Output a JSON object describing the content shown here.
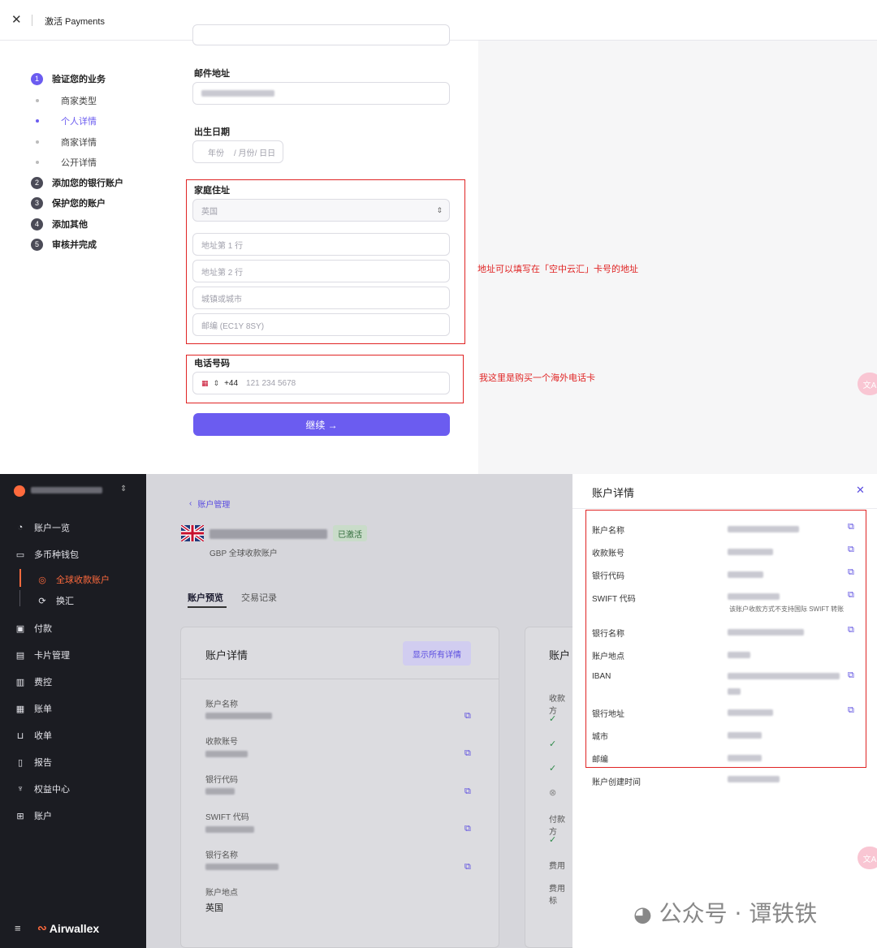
{
  "top": {
    "title": "激活 Payments",
    "close_icon": "close-icon",
    "steps": [
      {
        "num": "1",
        "label": "验证您的业务"
      },
      {
        "num": "2",
        "label": "添加您的银行账户"
      },
      {
        "num": "3",
        "label": "保护您的账户"
      },
      {
        "num": "4",
        "label": "添加其他"
      },
      {
        "num": "5",
        "label": "审核并完成"
      }
    ],
    "substeps": [
      "商家类型",
      "个人详情",
      "商家详情",
      "公开详情"
    ],
    "email_label": "邮件地址",
    "dob_label": "出生日期",
    "dob_year": "年份",
    "dob_month": "/ 月份",
    "dob_day": "/ 日日",
    "home_label": "家庭住址",
    "country": "英国",
    "addr1": "地址第 1 行",
    "addr2": "地址第 2 行",
    "city": "城镇或城市",
    "postcode": "邮编 (EC1Y 8SY)",
    "phone_label": "电话号码",
    "phone_code": "+44",
    "phone_placeholder": "121 234 5678",
    "continue": "继续 →",
    "note_address": "地址可以填写在「空中云汇」卡号的地址",
    "note_phone": "我这里是购买一个海外电话卡",
    "accent": "#6b5cf0",
    "annotation_color": "#e02424"
  },
  "sidebar": {
    "items": [
      {
        "icon": "gauge-icon",
        "label": "账户一览"
      },
      {
        "icon": "wallet-icon",
        "label": "多币种钱包"
      },
      {
        "icon": "payment-icon",
        "label": "付款"
      },
      {
        "icon": "card-icon",
        "label": "卡片管理"
      },
      {
        "icon": "expense-icon",
        "label": "费控"
      },
      {
        "icon": "bill-icon",
        "label": "账单"
      },
      {
        "icon": "cart-icon",
        "label": "收单"
      },
      {
        "icon": "report-icon",
        "label": "报告"
      },
      {
        "icon": "trophy-icon",
        "label": "权益中心"
      },
      {
        "icon": "store-icon",
        "label": "账户"
      }
    ],
    "subitems": [
      {
        "icon": "global-account-icon",
        "label": "全球收款账户"
      },
      {
        "icon": "exchange-icon",
        "label": "换汇"
      }
    ],
    "brand": "Airwallex",
    "active_color": "#ff6a3d"
  },
  "main": {
    "breadcrumb": "账户管理",
    "status": "已激活",
    "account_sub": "GBP 全球收款账户",
    "tabs": [
      "账户预览",
      "交易记录"
    ],
    "card_title": "账户详情",
    "show_all": "显示所有详情",
    "card2_title": "账户",
    "fields": [
      {
        "label": "账户名称"
      },
      {
        "label": "收款账号"
      },
      {
        "label": "银行代码"
      },
      {
        "label": "SWIFT 代码"
      },
      {
        "label": "银行名称"
      },
      {
        "label": "账户地点",
        "value": "英国"
      }
    ],
    "card2_lines": [
      "收款方",
      "付款方",
      "费用",
      "费用标"
    ]
  },
  "panel": {
    "title": "账户详情",
    "rows": [
      {
        "label": "账户名称"
      },
      {
        "label": "收款账号"
      },
      {
        "label": "银行代码"
      },
      {
        "label": "SWIFT 代码",
        "note": "该账户收款方式不支持国际 SWIFT 转账"
      },
      {
        "label": "银行名称"
      },
      {
        "label": "账户地点"
      },
      {
        "label": "IBAN"
      },
      {
        "label": "银行地址"
      },
      {
        "label": "城市"
      },
      {
        "label": "邮编"
      },
      {
        "label": "账户创建时间"
      }
    ]
  },
  "watermark": "公众号 · 谭铁铁"
}
